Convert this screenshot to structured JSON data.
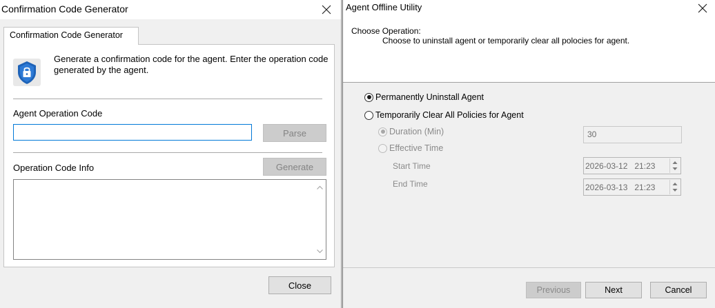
{
  "left_window": {
    "title": "Confirmation Code Generator",
    "tab_label": "Confirmation Code Generator",
    "description": "Generate a confirmation code for the agent. Enter the operation code generated by the agent.",
    "operation_code": {
      "label": "Agent Operation Code",
      "value": "",
      "parse_label": "Parse"
    },
    "code_info": {
      "label": "Operation Code Info",
      "generate_label": "Generate",
      "value": ""
    },
    "close_label": "Close",
    "icons": {
      "close": "close-icon",
      "app": "shield-lock-icon"
    },
    "colors": {
      "shield": "#1e63b8",
      "input_focus": "#0078d7"
    }
  },
  "right_window": {
    "title": "Agent Offline Utility",
    "header": {
      "title": "Choose Operation:",
      "subtitle": "Choose to uninstall agent or temporarily clear all polocies for agent."
    },
    "options": {
      "uninstall": {
        "label": "Permanently Uninstall Agent",
        "selected": true
      },
      "clear": {
        "label": "Temporarily Clear All Policies for Agent",
        "selected": false
      }
    },
    "sub_options": {
      "duration": {
        "label": "Duration (Min)",
        "selected": true,
        "value": "30"
      },
      "effective": {
        "label": "Effective Time",
        "selected": false
      },
      "start_time": {
        "label": "Start Time",
        "value": "2026-03-12   21:23"
      },
      "end_time": {
        "label": "End Time",
        "value": "2026-03-13   21:23"
      }
    },
    "buttons": {
      "previous": "Previous",
      "next": "Next",
      "cancel": "Cancel"
    }
  }
}
